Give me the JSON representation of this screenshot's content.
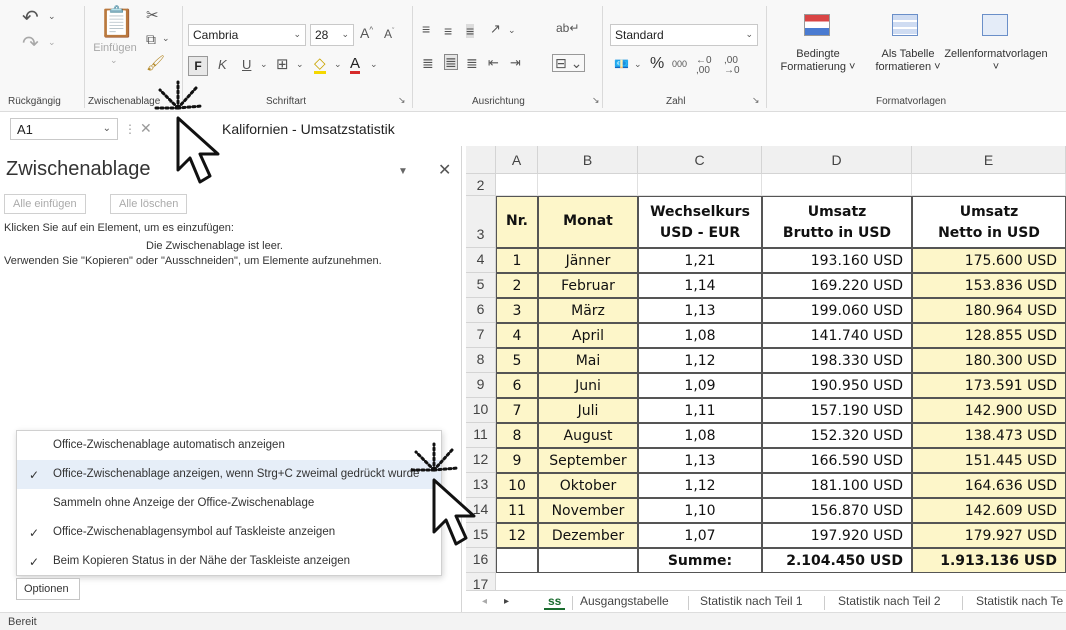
{
  "ribbon": {
    "groups": {
      "undo": "Rückgängig",
      "clipboard": "Zwischenablage",
      "font": "Schriftart",
      "alignment": "Ausrichtung",
      "number": "Zahl",
      "styles": "Formatvorlagen"
    },
    "paste_label": "Einfügen",
    "font_name": "Cambria",
    "font_size": "28",
    "number_format": "Standard",
    "cond_format": [
      "Bedingte",
      "Formatierung ˅"
    ],
    "as_table": [
      "Als Tabelle",
      "formatieren ˅"
    ],
    "cell_styles": "Zellenformatvorlagen",
    "bold": "F",
    "italic": "K",
    "underline": "U",
    "percent": "%",
    "thousands": "000",
    "accent_color": "#c0392b"
  },
  "formula_bar": {
    "cell_ref": "A1",
    "content": "Kalifornien - Umsatzstatistik"
  },
  "clipboard_pane": {
    "title": "Zwischenablage",
    "paste_all": "Alle einfügen",
    "clear_all": "Alle löschen",
    "hint": "Klicken Sie auf ein Element, um es einzufügen:",
    "empty": "Die Zwischenablage ist leer.",
    "usage": "Verwenden Sie \"Kopieren\" oder \"Ausschneiden\", um Elemente aufzunehmen.",
    "options_button": "Optionen",
    "menu": [
      {
        "label": "Office-Zwischenablage automatisch anzeigen",
        "checked": false
      },
      {
        "label": "Office-Zwischenablage anzeigen, wenn Strg+C zweimal gedrückt wurde",
        "checked": true
      },
      {
        "label": "Sammeln ohne Anzeige der Office-Zwischenablage",
        "checked": false
      },
      {
        "label": "Office-Zwischenablagensymbol auf Taskleiste anzeigen",
        "checked": true
      },
      {
        "label": "Beim Kopieren Status in der Nähe der Taskleiste anzeigen",
        "checked": true
      }
    ]
  },
  "sheet": {
    "columns": [
      "A",
      "B",
      "C",
      "D",
      "E"
    ],
    "row_numbers": [
      "2",
      "3",
      "4",
      "5",
      "6",
      "7",
      "8",
      "9",
      "10",
      "11",
      "12",
      "13",
      "14",
      "15",
      "16",
      "17"
    ],
    "header": {
      "nr": "Nr.",
      "monat": "Monat",
      "kurs": [
        "Wechselkurs",
        "USD - EUR"
      ],
      "brutto": [
        "Umsatz",
        "Brutto in USD"
      ],
      "netto": [
        "Umsatz",
        "Netto in USD"
      ]
    },
    "rows": [
      {
        "nr": "1",
        "monat": "Jänner",
        "kurs": "1,21",
        "brutto": "193.160 USD",
        "netto": "175.600 USD"
      },
      {
        "nr": "2",
        "monat": "Februar",
        "kurs": "1,14",
        "brutto": "169.220 USD",
        "netto": "153.836 USD"
      },
      {
        "nr": "3",
        "monat": "März",
        "kurs": "1,13",
        "brutto": "199.060 USD",
        "netto": "180.964 USD"
      },
      {
        "nr": "4",
        "monat": "April",
        "kurs": "1,08",
        "brutto": "141.740 USD",
        "netto": "128.855 USD"
      },
      {
        "nr": "5",
        "monat": "Mai",
        "kurs": "1,12",
        "brutto": "198.330 USD",
        "netto": "180.300 USD"
      },
      {
        "nr": "6",
        "monat": "Juni",
        "kurs": "1,09",
        "brutto": "190.950 USD",
        "netto": "173.591 USD"
      },
      {
        "nr": "7",
        "monat": "Juli",
        "kurs": "1,11",
        "brutto": "157.190 USD",
        "netto": "142.900 USD"
      },
      {
        "nr": "8",
        "monat": "August",
        "kurs": "1,08",
        "brutto": "152.320 USD",
        "netto": "138.473 USD"
      },
      {
        "nr": "9",
        "monat": "September",
        "kurs": "1,13",
        "brutto": "166.590 USD",
        "netto": "151.445 USD"
      },
      {
        "nr": "10",
        "monat": "Oktober",
        "kurs": "1,12",
        "brutto": "181.100 USD",
        "netto": "164.636 USD"
      },
      {
        "nr": "11",
        "monat": "November",
        "kurs": "1,10",
        "brutto": "156.870 USD",
        "netto": "142.609 USD"
      },
      {
        "nr": "12",
        "monat": "Dezember",
        "kurs": "1,07",
        "brutto": "197.920 USD",
        "netto": "179.927 USD"
      }
    ],
    "sum_label": "Summe:",
    "sum_brutto": "2.104.450 USD",
    "sum_netto": "1.913.136 USD",
    "highlight_color": "#fdf6c9"
  },
  "sheet_tabs": [
    "ss",
    "Ausgangstabelle",
    "Statistik nach Teil 1",
    "Statistik nach Teil 2",
    "Statistik nach Te"
  ],
  "status": "Bereit"
}
